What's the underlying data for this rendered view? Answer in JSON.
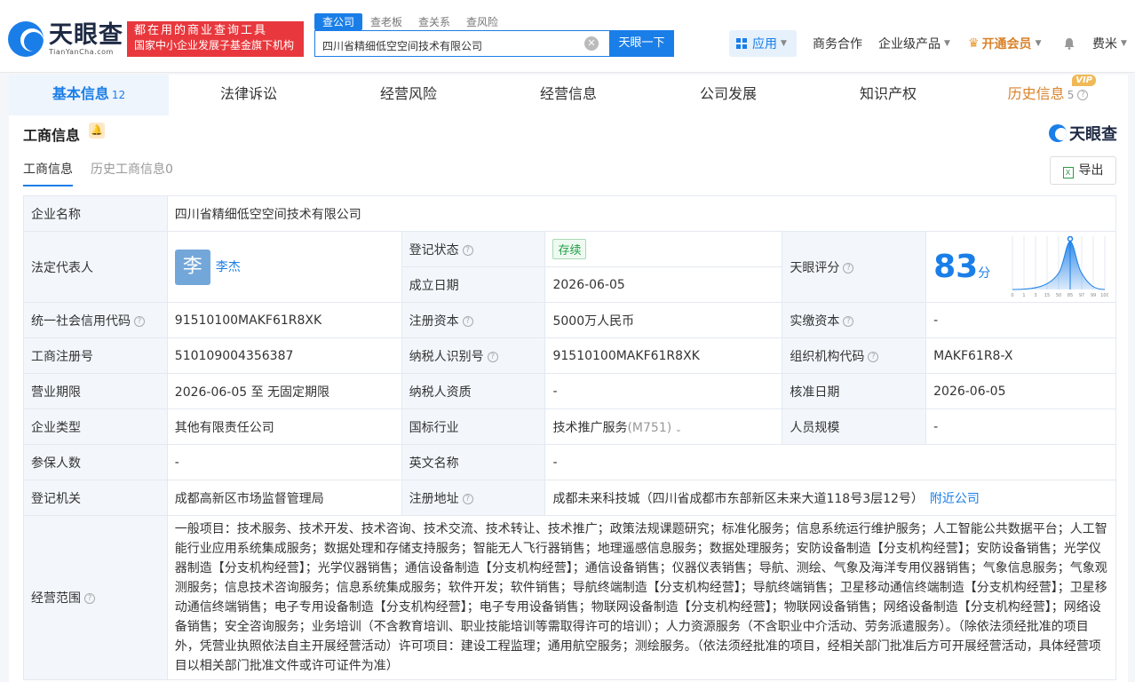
{
  "header": {
    "logo_cn": "天眼查",
    "logo_en": "TianYanCha.com",
    "slogan_line1": "都在用的商业查询工具",
    "slogan_line2": "国家中小企业发展子基金旗下机构",
    "search_tabs": [
      "查公司",
      "查老板",
      "查关系",
      "查风险"
    ],
    "search_value": "四川省精细低空空间技术有限公司",
    "search_button": "天眼一下",
    "app_label": "应用",
    "biz_coop": "商务合作",
    "enterprise_products": "企业级产品",
    "vip_label": "开通会员",
    "username": "费米"
  },
  "tabs": [
    {
      "label": "基本信息",
      "count": "12"
    },
    {
      "label": "法律诉讼"
    },
    {
      "label": "经营风险"
    },
    {
      "label": "经营信息"
    },
    {
      "label": "公司发展"
    },
    {
      "label": "知识产权"
    },
    {
      "label": "历史信息",
      "count": "5",
      "badge": "VIP"
    }
  ],
  "card": {
    "title": "工商信息",
    "brand": "天眼查",
    "sub_tabs": [
      "工商信息",
      "历史工商信息0"
    ],
    "export": "导出"
  },
  "info": {
    "company_name_label": "企业名称",
    "company_name": "四川省精细低空空间技术有限公司",
    "legal_rep_label": "法定代表人",
    "legal_rep_avatar": "李",
    "legal_rep": "李杰",
    "reg_status_label": "登记状态",
    "reg_status": "存续",
    "est_date_label": "成立日期",
    "est_date": "2026-06-05",
    "tyc_score_label": "天眼评分",
    "tyc_score": "83",
    "tyc_score_unit": "分",
    "credit_code_label": "统一社会信用代码",
    "credit_code": "91510100MAKF61R8XK",
    "reg_capital_label": "注册资本",
    "reg_capital": "5000万人民币",
    "paid_capital_label": "实缴资本",
    "paid_capital": "-",
    "reg_no_label": "工商注册号",
    "reg_no": "510109004356387",
    "tax_id_label": "纳税人识别号",
    "tax_id": "91510100MAKF61R8XK",
    "org_code_label": "组织机构代码",
    "org_code": "MAKF61R8-X",
    "term_label": "营业期限",
    "term": "2026-06-05 至 无固定期限",
    "taxpayer_qual_label": "纳税人资质",
    "taxpayer_qual": "-",
    "approval_date_label": "核准日期",
    "approval_date": "2026-06-05",
    "company_type_label": "企业类型",
    "company_type": "其他有限责任公司",
    "industry_label": "国标行业",
    "industry": "技术推广服务",
    "industry_code": "(M751)",
    "staff_size_label": "人员规模",
    "staff_size": "-",
    "insured_label": "参保人数",
    "insured": "-",
    "english_name_label": "英文名称",
    "english_name": "-",
    "reg_authority_label": "登记机关",
    "reg_authority": "成都高新区市场监督管理局",
    "reg_address_label": "注册地址",
    "reg_address": "成都未来科技城（四川省成都市东部新区未来大道118号3层12号）",
    "nearby": "附近公司",
    "scope_label": "经营范围",
    "scope": "一般项目：技术服务、技术开发、技术咨询、技术交流、技术转让、技术推广；政策法规课题研究；标准化服务；信息系统运行维护服务；人工智能公共数据平台；人工智能行业应用系统集成服务；数据处理和存储支持服务；智能无人飞行器销售；地理遥感信息服务；数据处理服务；安防设备制造【分支机构经营】；安防设备销售；光学仪器制造【分支机构经营】；光学仪器销售；通信设备制造【分支机构经营】；通信设备销售；仪器仪表销售；导航、测绘、气象及海洋专用仪器销售；气象信息服务；气象观测服务；信息技术咨询服务；信息系统集成服务；软件开发；软件销售；导航终端制造【分支机构经营】；导航终端销售；卫星移动通信终端制造【分支机构经营】；卫星移动通信终端销售；电子专用设备制造【分支机构经营】；电子专用设备销售；物联网设备制造【分支机构经营】；物联网设备销售；网络设备制造【分支机构经营】；网络设备销售；安全咨询服务；业务培训（不含教育培训、职业技能培训等需取得许可的培训）；人力资源服务（不含职业中介活动、劳务派遣服务）。（除依法须经批准的项目外，凭营业执照依法自主开展经营活动）许可项目：建设工程监理；通用航空服务；测绘服务。（依法须经批准的项目，经相关部门批准后方可开展经营活动，具体经营项目以相关部门批准文件或许可证件为准）"
  },
  "score_chart_ticks": [
    "0",
    "1",
    "3",
    "15",
    "50",
    "85",
    "97",
    "99",
    "100"
  ],
  "colors": {
    "brand_blue": "#1a7ee8",
    "slogan_red": "#e8383d",
    "vip_orange": "#d9822b"
  }
}
